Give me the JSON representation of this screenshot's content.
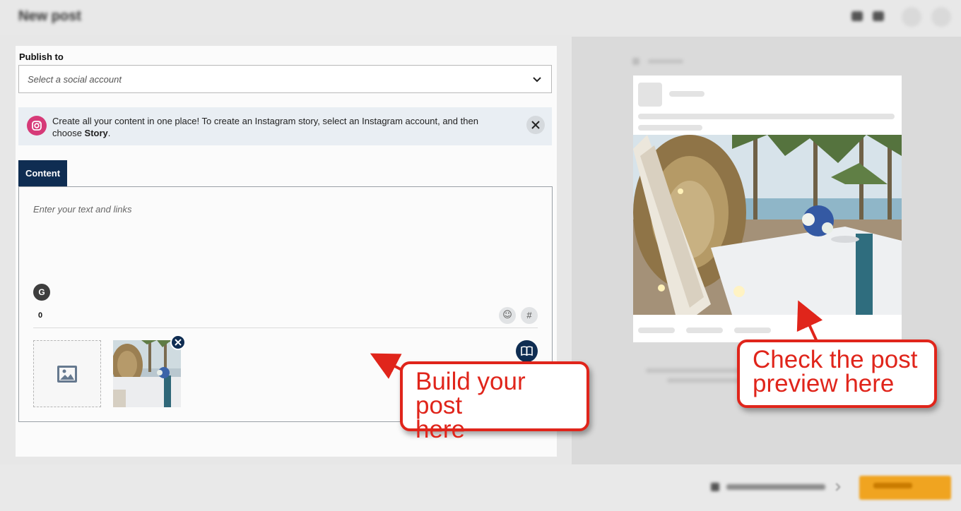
{
  "header": {
    "title": "New post"
  },
  "publish": {
    "label": "Publish to",
    "select_placeholder": "Select a social account"
  },
  "banner": {
    "text": "Create all your content in one place! To create an Instagram story, select an Instagram account, and then choose ",
    "bold": "Story",
    "suffix": "."
  },
  "tabs": [
    {
      "label": "Content",
      "active": true
    }
  ],
  "composer": {
    "placeholder": "Enter your text and links",
    "grammarly_letter": "G",
    "char_count": "0",
    "emoji_glyph": "☺",
    "hashtag_glyph": "#"
  },
  "callouts": {
    "left": [
      "Build your post",
      "here"
    ],
    "right": [
      "Check the post",
      "preview here"
    ]
  },
  "colors": {
    "primary": "#0f2d52",
    "instagram": "#d63a78",
    "callout": "#e0251b",
    "publish_button": "#f0a420"
  },
  "icons": {
    "select": "chevron-down-icon",
    "banner": "instagram-icon",
    "banner_close": "close-icon",
    "composer": [
      "grammarly-icon",
      "emoji-icon",
      "hashtag-icon",
      "image-placeholder-icon",
      "remove-icon",
      "media-library-icon"
    ]
  }
}
